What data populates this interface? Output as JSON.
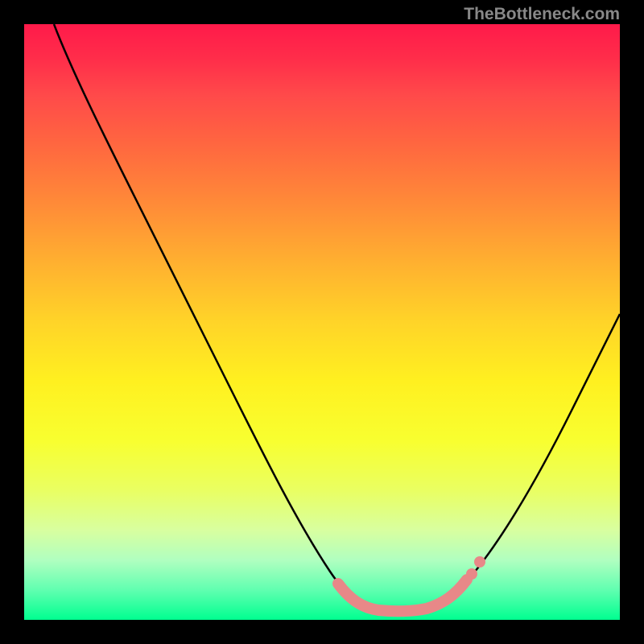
{
  "watermark": "TheBottleneck.com",
  "chart_data": {
    "type": "line",
    "title": "",
    "xlabel": "",
    "ylabel": "",
    "xlim": [
      0,
      100
    ],
    "ylim": [
      0,
      100
    ],
    "grid": false,
    "legend": false,
    "series": [
      {
        "name": "bottleneck-curve",
        "color": "#000000",
        "points": [
          {
            "x": 5,
            "y": 100
          },
          {
            "x": 10,
            "y": 92
          },
          {
            "x": 15,
            "y": 82
          },
          {
            "x": 20,
            "y": 72
          },
          {
            "x": 25,
            "y": 62
          },
          {
            "x": 30,
            "y": 52
          },
          {
            "x": 35,
            "y": 42
          },
          {
            "x": 40,
            "y": 32
          },
          {
            "x": 45,
            "y": 22
          },
          {
            "x": 50,
            "y": 12
          },
          {
            "x": 55,
            "y": 6
          },
          {
            "x": 60,
            "y": 3
          },
          {
            "x": 65,
            "y": 2
          },
          {
            "x": 70,
            "y": 3
          },
          {
            "x": 75,
            "y": 7
          },
          {
            "x": 80,
            "y": 14
          },
          {
            "x": 85,
            "y": 24
          },
          {
            "x": 90,
            "y": 35
          },
          {
            "x": 95,
            "y": 47
          },
          {
            "x": 100,
            "y": 58
          }
        ]
      },
      {
        "name": "optimal-zone-highlight",
        "color": "#e88888",
        "points": [
          {
            "x": 55,
            "y": 6
          },
          {
            "x": 60,
            "y": 3
          },
          {
            "x": 65,
            "y": 2
          },
          {
            "x": 70,
            "y": 3
          },
          {
            "x": 75,
            "y": 7
          }
        ]
      }
    ],
    "annotations": []
  }
}
